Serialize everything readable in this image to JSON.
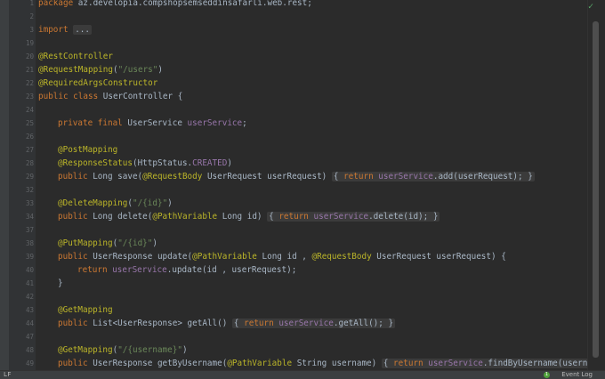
{
  "editor": {
    "lines": [
      {
        "n": "1",
        "t": "package az.developia.compshopsemseddinsafarli.web.rest;"
      },
      {
        "n": "3",
        "t": "import ..."
      },
      {
        "n": "20",
        "t": "@RestController"
      },
      {
        "n": "21",
        "t": "@RequestMapping(\"/users\")"
      },
      {
        "n": "22",
        "t": "@RequiredArgsConstructor"
      },
      {
        "n": "23",
        "t": "public class UserController {"
      },
      {
        "n": "25",
        "t": "private final UserService userService;"
      },
      {
        "n": "27",
        "t": "@PostMapping"
      },
      {
        "n": "28",
        "t": "@ResponseStatus(HttpStatus.CREATED)"
      },
      {
        "n": "29",
        "t": "public Long save(@RequestBody UserRequest userRequest) { return userService.add(userRequest); }"
      },
      {
        "n": "33",
        "t": "@DeleteMapping(\"/{id}\")"
      },
      {
        "n": "34",
        "t": "public Long delete(@PathVariable Long id) { return userService.delete(id); }"
      },
      {
        "n": "38",
        "t": "@PutMapping(\"/{id}\")"
      },
      {
        "n": "39",
        "t": "public UserResponse update(@PathVariable Long id , @RequestBody UserRequest userRequest) {"
      },
      {
        "n": "40",
        "t": "return userService.update(id , userRequest);"
      },
      {
        "n": "41",
        "t": "}"
      },
      {
        "n": "43",
        "t": "@GetMapping"
      },
      {
        "n": "44",
        "t": "public List<UserResponse> getAll() { return userService.getAll(); }"
      },
      {
        "n": "48",
        "t": "@GetMapping(\"/{username}\")"
      },
      {
        "n": "49",
        "t": "public UserResponse getByUsername(@PathVariable String username) { return userService.findByUsername(username); }"
      }
    ],
    "blank_line_numbers": [
      "2",
      "19",
      "24",
      "26",
      "32",
      "37",
      "42",
      "47"
    ]
  },
  "status": {
    "left_text": "LF",
    "event_log_label": "Event Log",
    "event_count": "1"
  },
  "colors": {
    "background": "#2b2b2b",
    "keyword": "#cc7832",
    "annotation": "#bbb529",
    "string": "#6a8759",
    "field": "#9876aa",
    "text": "#a9b7c6"
  },
  "icons": {
    "inspection": "check-icon",
    "event_log": "event-log-icon"
  }
}
